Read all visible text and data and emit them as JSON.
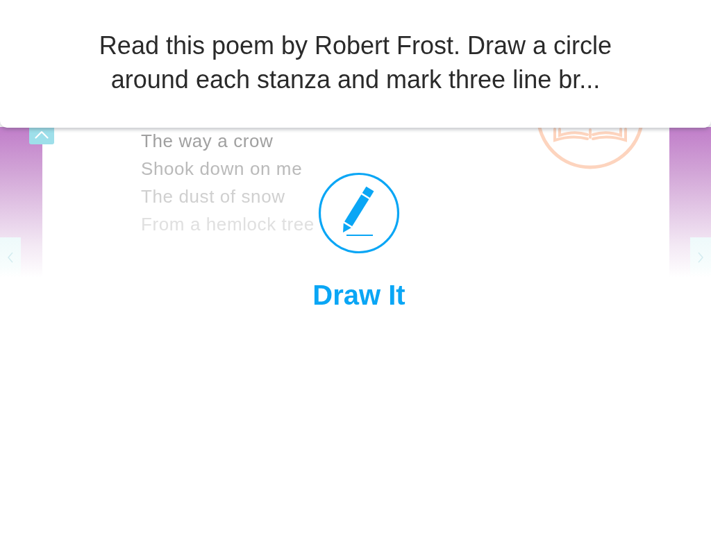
{
  "header": {
    "instruction": "Read this poem by Robert Frost. Draw a circle around each stanza and mark three line br..."
  },
  "poem": {
    "lines": [
      "The way a crow",
      "Shook down on me",
      "The dust of snow",
      "From a hemlock tree"
    ]
  },
  "action": {
    "label": "Draw It"
  }
}
